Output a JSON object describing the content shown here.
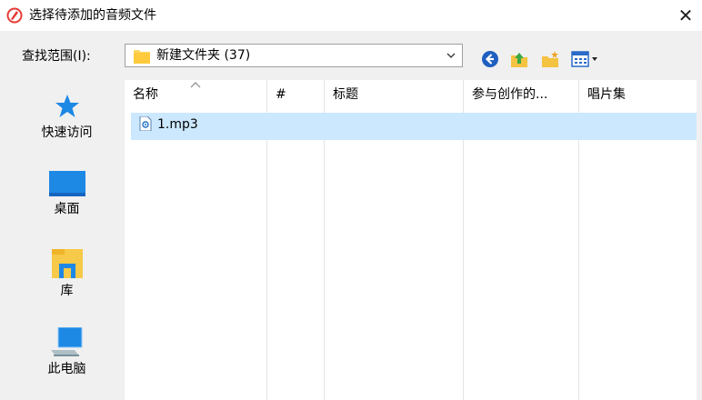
{
  "window": {
    "title": "选择待添加的音频文件",
    "close_symbol": "✕"
  },
  "lookin": {
    "label": "查找范围(I):",
    "value": "新建文件夹 (37)"
  },
  "toolbar": {
    "icons": [
      "back-icon",
      "up-folder-icon",
      "new-folder-icon",
      "view-menu-icon"
    ]
  },
  "places": [
    {
      "label": "快速访问",
      "icon": "star-icon"
    },
    {
      "label": "桌面",
      "icon": "desktop-icon"
    },
    {
      "label": "库",
      "icon": "library-icon"
    },
    {
      "label": "此电脑",
      "icon": "computer-icon"
    }
  ],
  "columns": [
    "名称",
    "#",
    "标题",
    "参与创作的...",
    "唱片集"
  ],
  "files": [
    {
      "name": "1.mp3",
      "selected": true
    }
  ],
  "colors": {
    "selection": "#cce8ff",
    "background": "#f0f0f0",
    "accent": "#1e90ff"
  }
}
